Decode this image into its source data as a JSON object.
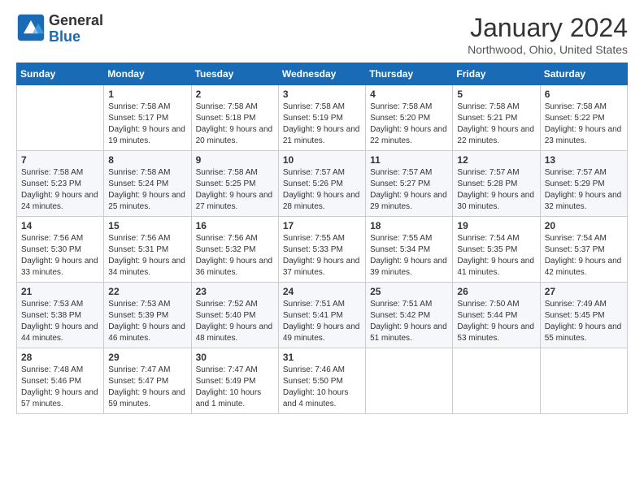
{
  "logo": {
    "general": "General",
    "blue": "Blue"
  },
  "title": "January 2024",
  "location": "Northwood, Ohio, United States",
  "days_of_week": [
    "Sunday",
    "Monday",
    "Tuesday",
    "Wednesday",
    "Thursday",
    "Friday",
    "Saturday"
  ],
  "weeks": [
    [
      {
        "day": "",
        "sunrise": "",
        "sunset": "",
        "daylight": ""
      },
      {
        "day": "1",
        "sunrise": "7:58 AM",
        "sunset": "5:17 PM",
        "daylight": "9 hours and 19 minutes."
      },
      {
        "day": "2",
        "sunrise": "7:58 AM",
        "sunset": "5:18 PM",
        "daylight": "9 hours and 20 minutes."
      },
      {
        "day": "3",
        "sunrise": "7:58 AM",
        "sunset": "5:19 PM",
        "daylight": "9 hours and 21 minutes."
      },
      {
        "day": "4",
        "sunrise": "7:58 AM",
        "sunset": "5:20 PM",
        "daylight": "9 hours and 22 minutes."
      },
      {
        "day": "5",
        "sunrise": "7:58 AM",
        "sunset": "5:21 PM",
        "daylight": "9 hours and 22 minutes."
      },
      {
        "day": "6",
        "sunrise": "7:58 AM",
        "sunset": "5:22 PM",
        "daylight": "9 hours and 23 minutes."
      }
    ],
    [
      {
        "day": "7",
        "sunrise": "7:58 AM",
        "sunset": "5:23 PM",
        "daylight": "9 hours and 24 minutes."
      },
      {
        "day": "8",
        "sunrise": "7:58 AM",
        "sunset": "5:24 PM",
        "daylight": "9 hours and 25 minutes."
      },
      {
        "day": "9",
        "sunrise": "7:58 AM",
        "sunset": "5:25 PM",
        "daylight": "9 hours and 27 minutes."
      },
      {
        "day": "10",
        "sunrise": "7:57 AM",
        "sunset": "5:26 PM",
        "daylight": "9 hours and 28 minutes."
      },
      {
        "day": "11",
        "sunrise": "7:57 AM",
        "sunset": "5:27 PM",
        "daylight": "9 hours and 29 minutes."
      },
      {
        "day": "12",
        "sunrise": "7:57 AM",
        "sunset": "5:28 PM",
        "daylight": "9 hours and 30 minutes."
      },
      {
        "day": "13",
        "sunrise": "7:57 AM",
        "sunset": "5:29 PM",
        "daylight": "9 hours and 32 minutes."
      }
    ],
    [
      {
        "day": "14",
        "sunrise": "7:56 AM",
        "sunset": "5:30 PM",
        "daylight": "9 hours and 33 minutes."
      },
      {
        "day": "15",
        "sunrise": "7:56 AM",
        "sunset": "5:31 PM",
        "daylight": "9 hours and 34 minutes."
      },
      {
        "day": "16",
        "sunrise": "7:56 AM",
        "sunset": "5:32 PM",
        "daylight": "9 hours and 36 minutes."
      },
      {
        "day": "17",
        "sunrise": "7:55 AM",
        "sunset": "5:33 PM",
        "daylight": "9 hours and 37 minutes."
      },
      {
        "day": "18",
        "sunrise": "7:55 AM",
        "sunset": "5:34 PM",
        "daylight": "9 hours and 39 minutes."
      },
      {
        "day": "19",
        "sunrise": "7:54 AM",
        "sunset": "5:35 PM",
        "daylight": "9 hours and 41 minutes."
      },
      {
        "day": "20",
        "sunrise": "7:54 AM",
        "sunset": "5:37 PM",
        "daylight": "9 hours and 42 minutes."
      }
    ],
    [
      {
        "day": "21",
        "sunrise": "7:53 AM",
        "sunset": "5:38 PM",
        "daylight": "9 hours and 44 minutes."
      },
      {
        "day": "22",
        "sunrise": "7:53 AM",
        "sunset": "5:39 PM",
        "daylight": "9 hours and 46 minutes."
      },
      {
        "day": "23",
        "sunrise": "7:52 AM",
        "sunset": "5:40 PM",
        "daylight": "9 hours and 48 minutes."
      },
      {
        "day": "24",
        "sunrise": "7:51 AM",
        "sunset": "5:41 PM",
        "daylight": "9 hours and 49 minutes."
      },
      {
        "day": "25",
        "sunrise": "7:51 AM",
        "sunset": "5:42 PM",
        "daylight": "9 hours and 51 minutes."
      },
      {
        "day": "26",
        "sunrise": "7:50 AM",
        "sunset": "5:44 PM",
        "daylight": "9 hours and 53 minutes."
      },
      {
        "day": "27",
        "sunrise": "7:49 AM",
        "sunset": "5:45 PM",
        "daylight": "9 hours and 55 minutes."
      }
    ],
    [
      {
        "day": "28",
        "sunrise": "7:48 AM",
        "sunset": "5:46 PM",
        "daylight": "9 hours and 57 minutes."
      },
      {
        "day": "29",
        "sunrise": "7:47 AM",
        "sunset": "5:47 PM",
        "daylight": "9 hours and 59 minutes."
      },
      {
        "day": "30",
        "sunrise": "7:47 AM",
        "sunset": "5:49 PM",
        "daylight": "10 hours and 1 minute."
      },
      {
        "day": "31",
        "sunrise": "7:46 AM",
        "sunset": "5:50 PM",
        "daylight": "10 hours and 4 minutes."
      },
      {
        "day": "",
        "sunrise": "",
        "sunset": "",
        "daylight": ""
      },
      {
        "day": "",
        "sunrise": "",
        "sunset": "",
        "daylight": ""
      },
      {
        "day": "",
        "sunrise": "",
        "sunset": "",
        "daylight": ""
      }
    ]
  ]
}
